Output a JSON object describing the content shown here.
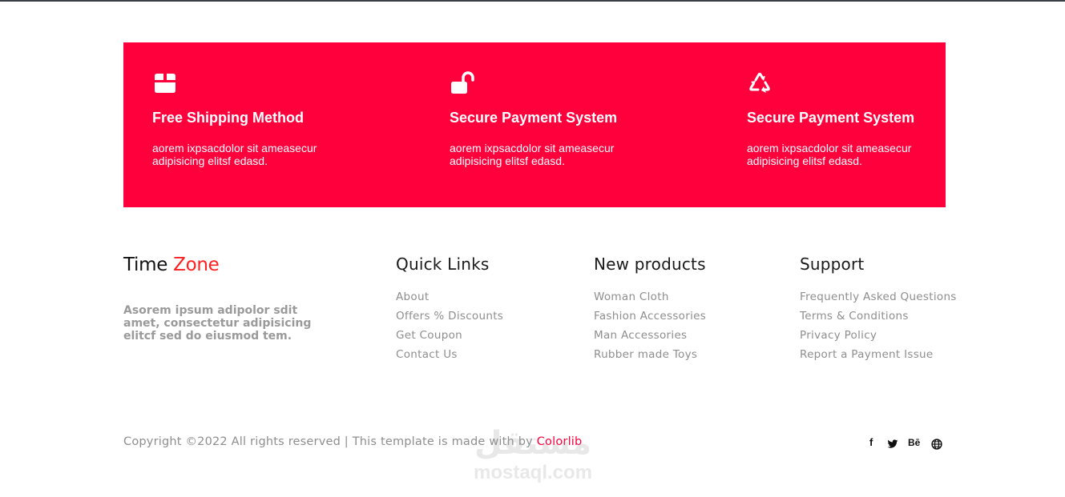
{
  "features": [
    {
      "icon": "box-icon",
      "title": "Free Shipping Method",
      "desc": "aorem ixpsacdolor sit ameasecur adipisicing elitsf edasd."
    },
    {
      "icon": "unlock-icon",
      "title": "Secure Payment System",
      "desc": "aorem ixpsacdolor sit ameasecur adipisicing elitsf edasd."
    },
    {
      "icon": "recycle-icon",
      "title": "Secure Payment System",
      "desc": "aorem ixpsacdolor sit ameasecur adipisicing elitsf edasd."
    }
  ],
  "brand": {
    "name": "Time",
    "accent": "Zone"
  },
  "about_text": "Asorem ipsum adipolor sdit amet, consectetur adipisicing elitcf sed do eiusmod tem.",
  "columns": [
    {
      "title": "Quick Links",
      "links": [
        "About",
        "Offers % Discounts",
        "Get Coupon",
        "Contact Us"
      ]
    },
    {
      "title": "New products",
      "links": [
        "Woman Cloth",
        "Fashion Accessories",
        "Man Accessories",
        "Rubber made Toys"
      ]
    },
    {
      "title": "Support",
      "links": [
        "Frequently Asked Questions",
        "Terms & Conditions",
        "Privacy Policy",
        "Report a Payment Issue"
      ]
    }
  ],
  "copyright": {
    "text": "Copyright ©2022 All rights reserved | This template is made with by ",
    "credit": "Colorlib"
  },
  "social": [
    {
      "icon": "facebook-icon",
      "glyph": "f"
    },
    {
      "icon": "twitter-icon",
      "glyph": ""
    },
    {
      "icon": "behance-icon",
      "glyph": "Bē"
    },
    {
      "icon": "globe-icon",
      "glyph": ""
    }
  ],
  "watermark": {
    "arabic": "مستقل",
    "latin": "mostaql.com"
  },
  "colors": {
    "accent": "#ff003c",
    "brand_accent": "#ff2020",
    "muted_text": "#8e8e8e"
  }
}
